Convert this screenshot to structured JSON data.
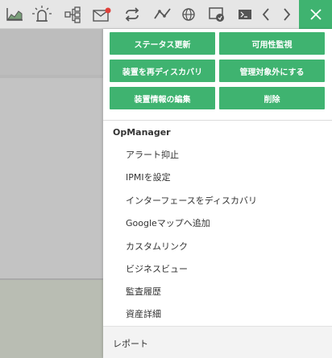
{
  "toolbar": {
    "icons": [
      "graph-icon",
      "alarm-icon",
      "topology-icon",
      "mail-icon",
      "repeat-icon",
      "line-chart-icon",
      "globe-icon",
      "remote-icon",
      "terminal-icon",
      "chevron-left-icon",
      "chevron-right-icon"
    ],
    "close_icon": "close-icon"
  },
  "actions": {
    "status_update": "ステータス更新",
    "availability_monitor": "可用性監視",
    "rediscover": "装置を再ディスカバリ",
    "unmanage": "管理対象外にする",
    "edit_device_info": "装置情報の編集",
    "delete": "削除"
  },
  "opmanager": {
    "title": "OpManager",
    "items": [
      "アラート抑止",
      "IPMIを設定",
      "インターフェースをディスカバリ",
      "Googleマップへ追加",
      "カスタムリンク",
      "ビジネスビュー",
      "監査履歴",
      "資産詳細"
    ]
  },
  "report": {
    "title": "レポート"
  },
  "colors": {
    "accent": "#3fb370",
    "toolbar_bg": "#e6e6e6",
    "overlay_bg": "#c3c3c3"
  }
}
